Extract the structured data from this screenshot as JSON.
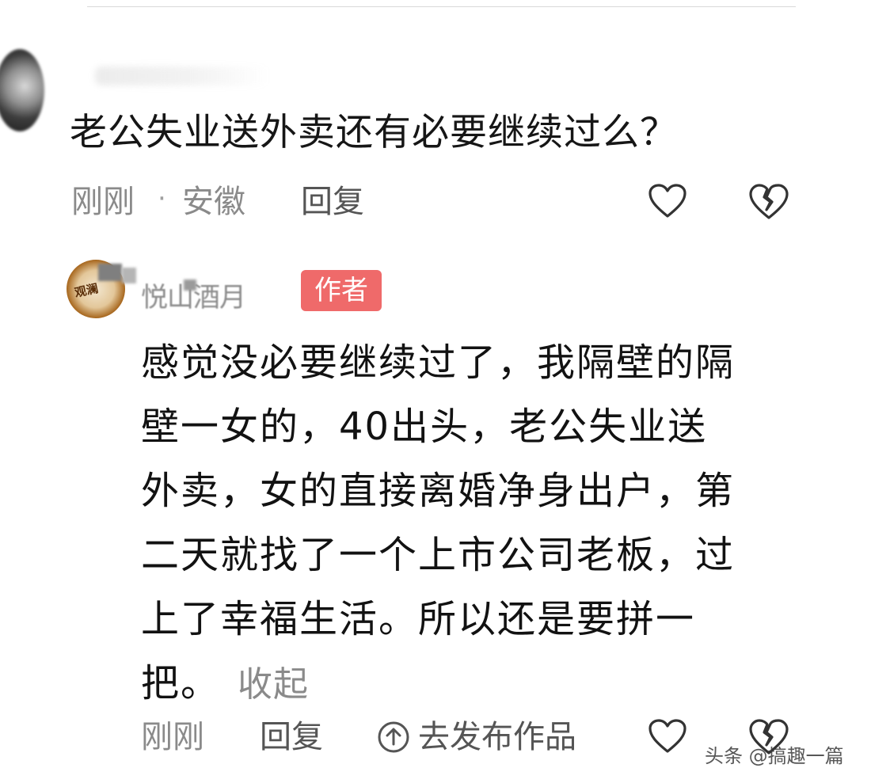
{
  "comment": {
    "text": "老公失业送外卖还有必要继续过么？",
    "time": "刚刚",
    "separator": "·",
    "location": "安徽",
    "reply_label": "回复",
    "like_icon": "heart-outline-icon",
    "dislike_icon": "broken-heart-icon"
  },
  "reply": {
    "author_name": "悦山酒月",
    "author_badge": "作者",
    "avatar_text": "观澜",
    "body_lines": [
      "感觉没必要继续过了，我隔壁的隔",
      "壁一女的，40出头，老公失业送",
      "外卖，女的直接离婚净身出户，第",
      "二天就找了一个上市公司老板，过",
      "上了幸福生活。所以还是要拼一",
      "把。"
    ],
    "collapse_label": "收起",
    "time": "刚刚",
    "reply_label": "回复",
    "publish_label": "去发布作品",
    "publish_icon": "arrow-up-circle-icon"
  },
  "watermark": "头条 @搞趣一篇",
  "colors": {
    "badge_bg": "#ef6a6a",
    "meta_text": "#8a8a8a",
    "body_text": "#121212"
  }
}
